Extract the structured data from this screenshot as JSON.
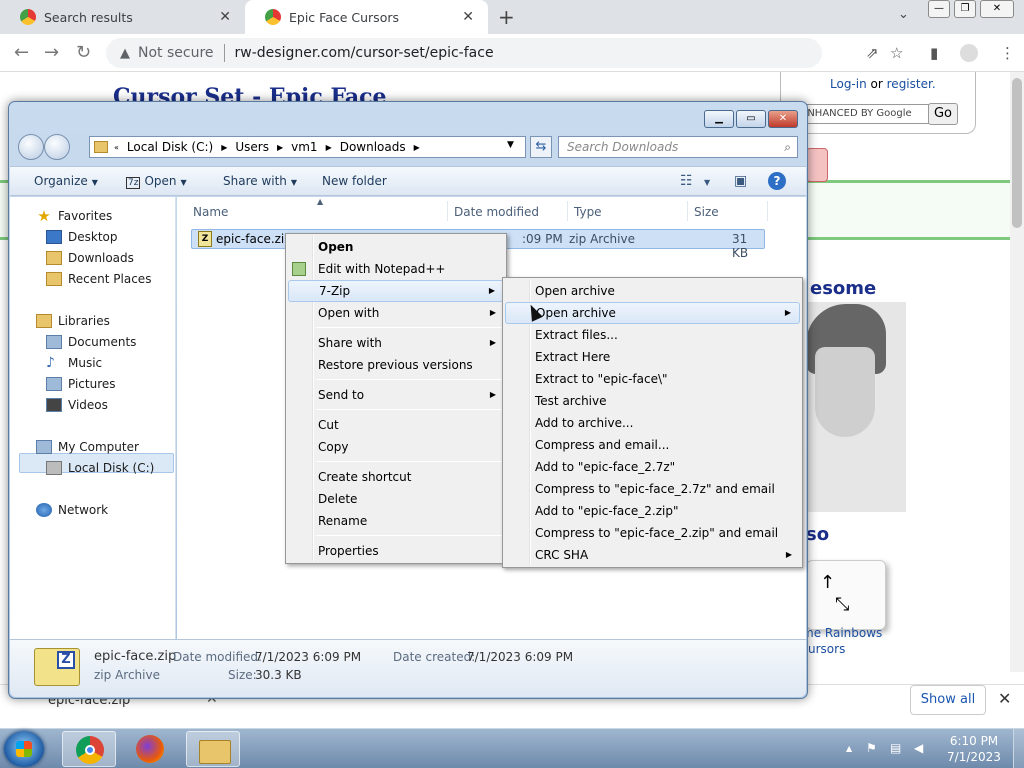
{
  "browser": {
    "tabs": [
      {
        "label": "Search results"
      },
      {
        "label": "Epic Face Cursors"
      }
    ],
    "security": "Not secure",
    "url": "rw-designer.com/cursor-set/epic-face"
  },
  "page": {
    "title": "Cursor Set - Epic Face",
    "login": "Log-in",
    "or": "or",
    "register": "register.",
    "search_placeholder": "ENHANCED BY Google",
    "go": "Go",
    "awesome": "esome",
    "also": "so",
    "rainbows_line1": "me Rainbows",
    "rainbows_line2": "ursors"
  },
  "downloads": {
    "item": "epic-face.zip",
    "show_all": "Show all"
  },
  "explorer": {
    "breadcrumb": [
      "Local Disk (C:)",
      "Users",
      "vm1",
      "Downloads"
    ],
    "search_placeholder": "Search Downloads",
    "toolbar": {
      "organize": "Organize",
      "open": "Open",
      "share": "Share with",
      "new_folder": "New folder"
    },
    "nav": {
      "favorites": "Favorites",
      "desktop": "Desktop",
      "downloads": "Downloads",
      "recent": "Recent Places",
      "libraries": "Libraries",
      "documents": "Documents",
      "music": "Music",
      "pictures": "Pictures",
      "videos": "Videos",
      "computer": "My Computer",
      "local_disk": "Local Disk (C:)",
      "network": "Network"
    },
    "columns": {
      "name": "Name",
      "date": "Date modified",
      "type": "Type",
      "size": "Size"
    },
    "file": {
      "name": "epic-face.zip",
      "date": ":09 PM",
      "type": "zip Archive",
      "size": "31 KB"
    },
    "details": {
      "name": "epic-face.zip",
      "type": "zip Archive",
      "date_mod_label": "Date modified:",
      "date_mod": "7/1/2023 6:09 PM",
      "date_created_label": "Date created:",
      "date_created": "7/1/2023 6:09 PM",
      "size_label": "Size:",
      "size": "30.3 KB"
    }
  },
  "context_menu": {
    "open": "Open",
    "edit_notepad": "Edit with Notepad++",
    "seven_zip": "7-Zip",
    "open_with": "Open with",
    "share_with": "Share with",
    "restore": "Restore previous versions",
    "send_to": "Send to",
    "cut": "Cut",
    "copy": "Copy",
    "create_shortcut": "Create shortcut",
    "delete": "Delete",
    "rename": "Rename",
    "properties": "Properties"
  },
  "zip_menu": {
    "open_archive": "Open archive",
    "open_archive_sub": "Open archive",
    "extract_files": "Extract files...",
    "extract_here": "Extract Here",
    "extract_to": "Extract to \"epic-face\\\"",
    "test": "Test archive",
    "add": "Add to archive...",
    "compress_email": "Compress and email...",
    "add_7z": "Add to \"epic-face_2.7z\"",
    "compress_7z_email": "Compress to \"epic-face_2.7z\" and email",
    "add_zip": "Add to \"epic-face_2.zip\"",
    "compress_zip_email": "Compress to \"epic-face_2.zip\" and email",
    "crc": "CRC SHA"
  },
  "taskbar": {
    "time": "6:10 PM",
    "date": "7/1/2023"
  }
}
